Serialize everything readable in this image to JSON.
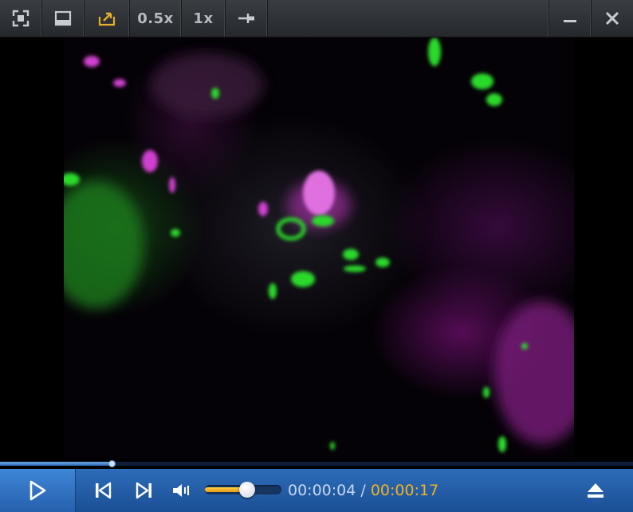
{
  "toolbar": {
    "fullscreen_icon": "fullscreen-icon",
    "layout_icon": "window-layout-icon",
    "open_icon": "open-file-icon",
    "zoom_half_label": "0.5x",
    "zoom_one_label": "1x",
    "pin_icon": "pin-icon",
    "minimize_icon": "minimize-icon",
    "close_icon": "close-icon",
    "accent_color": "#e8b02a"
  },
  "video": {
    "content": "fluorescence-microscopy-frame",
    "colors": {
      "green": "#2bd92b",
      "magenta": "#d040d0"
    }
  },
  "seek": {
    "progress": 0.176,
    "fill_color": "#4a8ad6"
  },
  "controls": {
    "play_icon": "play-icon",
    "prev_icon": "skip-previous-icon",
    "next_icon": "skip-next-icon",
    "volume_icon": "volume-icon",
    "volume_level": 0.55,
    "current_time": "00:00:04",
    "separator": "/",
    "total_time": "00:00:17",
    "eject_icon": "eject-icon",
    "current_time_color": "#c6d8ef",
    "total_time_color": "#f0b320"
  }
}
